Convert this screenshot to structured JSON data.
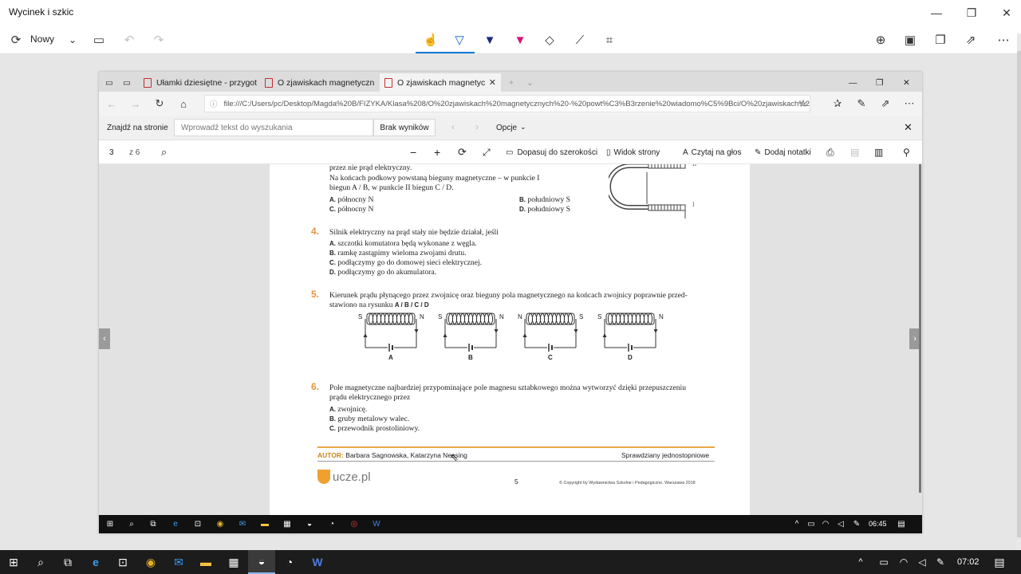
{
  "app": {
    "title": "Wycinek i szkic",
    "new_label": "Nowy"
  },
  "edge": {
    "tabs": [
      {
        "label": "Ułamki dziesiętne - przygot"
      },
      {
        "label": "O zjawiskach magnetyczn"
      },
      {
        "label": "O zjawiskach magnetyc"
      }
    ],
    "address": "file:///C:/Users/pc/Desktop/Magda%20B/FIZYKA/Klasa%208/O%20zjawiskach%20magnetycznych%20-%20powt%C3%B3rzenie%20wiadomo%C5%9Bci/O%20zjawiskach%20magne",
    "find": {
      "label": "Znajdź na stronie",
      "placeholder": "Wprowadź tekst do wyszukania",
      "status": "Brak wyników",
      "options": "Opcje"
    },
    "pdf_toolbar": {
      "page": "3",
      "of": "z 6",
      "fit_width": "Dopasuj do szerokości",
      "page_view": "Widok strony",
      "read_aloud": "Czytaj na głos",
      "add_notes": "Dodaj notatki"
    }
  },
  "document": {
    "top_lines": [
      "przez nie prąd elektryczny.",
      "Na końcach podkowy powstaną bieguny magnetyczne – w punkcie I",
      "biegun A / B, w punkcie II biegun C / D."
    ],
    "q3_options": [
      {
        "letter": "A.",
        "text": "północny N"
      },
      {
        "letter": "B.",
        "text": "południowy S"
      },
      {
        "letter": "C.",
        "text": "północny N"
      },
      {
        "letter": "D.",
        "text": "południowy S"
      }
    ],
    "horseshoe_labels": [
      "II",
      "I"
    ],
    "q4": {
      "number": "4.",
      "question": "Silnik elektryczny na prąd stały nie będzie działał, jeśli",
      "options": [
        {
          "letter": "A.",
          "text": "szczotki komutatora będą wykonane z węgla."
        },
        {
          "letter": "B.",
          "text": "ramkę zastąpimy wieloma zwojami drutu."
        },
        {
          "letter": "C.",
          "text": "podłączymy go do domowej sieci elektrycznej."
        },
        {
          "letter": "D.",
          "text": "podłączymy go do akumulatora."
        }
      ]
    },
    "q5": {
      "number": "5.",
      "question_line1": "Kierunek prądu płynącego przez zwojnicę oraz bieguny pola magnetycznego na końcach zwojnicy poprawnie przed-",
      "question_line2": "stawiono na rysunku",
      "answer_letters": "A / B / C / D",
      "figures": [
        {
          "label": "A",
          "left_pole": "S",
          "right_pole": "N"
        },
        {
          "label": "B",
          "left_pole": "S",
          "right_pole": "N"
        },
        {
          "label": "C",
          "left_pole": "N",
          "right_pole": "S"
        },
        {
          "label": "D",
          "left_pole": "S",
          "right_pole": "N"
        }
      ]
    },
    "q6": {
      "number": "6.",
      "question_line1": "Pole magnetyczne najbardziej przypominające pole magnesu sztabkowego można wytworzyć dzięki przepuszczeniu",
      "question_line2": "prądu elektrycznego przez",
      "options": [
        {
          "letter": "A.",
          "text": "zwojnicę."
        },
        {
          "letter": "B.",
          "text": "gruby metalowy walec."
        },
        {
          "letter": "C.",
          "text": "przewodnik prostoliniowy."
        }
      ]
    },
    "footer": {
      "author_label": "AUTOR:",
      "author": "Barbara Sagnowska, Katarzyna Nessing",
      "series": "Sprawdziany jednostopniowe",
      "logo": "ucze.pl",
      "page_number": "5",
      "copyright": "© Copyright by Wydawnictwa Szkolne i Pedagogiczne, Warszawa 2018"
    }
  },
  "taskbar": {
    "inner_time": "06:45",
    "time": "07:02"
  },
  "colors": {
    "accent": "#0078d7",
    "question_number": "#e8923a",
    "footer_line": "#e8a54a"
  }
}
